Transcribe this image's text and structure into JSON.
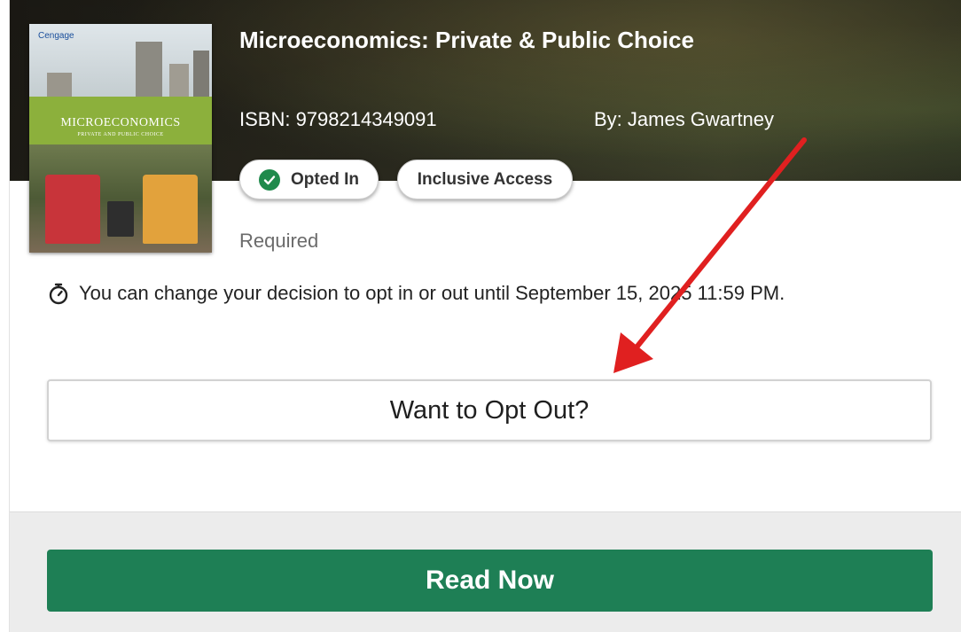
{
  "book": {
    "title": "Microeconomics: Private & Public Choice",
    "isbn": "ISBN: 9798214349091",
    "author": "By: James Gwartney",
    "cover": {
      "publisher": "Cengage",
      "title": "MICROECONOMICS",
      "subtitle": "PRIVATE AND PUBLIC CHOICE"
    }
  },
  "badges": {
    "opted_in": "Opted In",
    "access_type": "Inclusive Access"
  },
  "status": {
    "requirement": "Required"
  },
  "deadline_notice": "You can change your decision to opt in or out until September 15, 2025 11:59 PM.",
  "actions": {
    "opt_out_label": "Want to Opt Out?",
    "read_now_label": "Read Now"
  },
  "colors": {
    "accent_green": "#1e7f55",
    "check_green": "#1f8a4c",
    "annotation_red": "#e02020"
  },
  "icons": {
    "badge_check": "check-circle-icon",
    "deadline": "stopwatch-icon",
    "annotation": "red-arrow-annotation"
  }
}
